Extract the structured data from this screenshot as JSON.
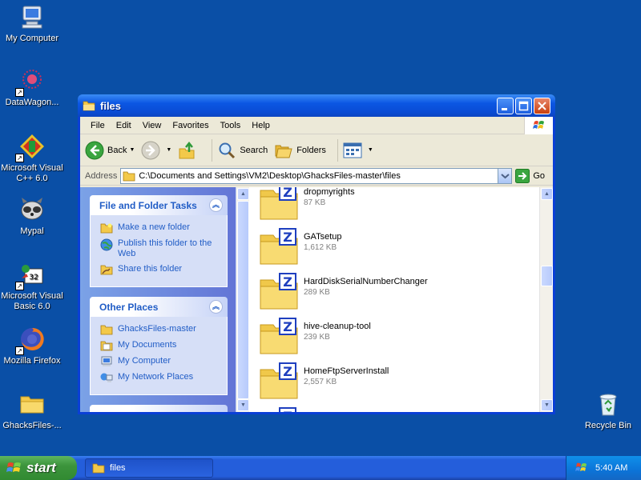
{
  "desktop": {
    "icons": [
      {
        "label": "My Computer",
        "icon": "my-computer-icon"
      },
      {
        "label": "DataWagon...",
        "icon": "datawagon-icon"
      },
      {
        "label": "Microsoft Visual C++ 6.0",
        "icon": "visual-cpp-icon"
      },
      {
        "label": "Mypal",
        "icon": "mypal-icon"
      },
      {
        "label": "Microsoft Visual Basic 6.0",
        "icon": "visual-basic-icon"
      },
      {
        "label": "Mozilla Firefox",
        "icon": "firefox-icon"
      },
      {
        "label": "GhacksFiles-...",
        "icon": "folder-icon"
      },
      {
        "label": "Recycle Bin",
        "icon": "recycle-bin-icon"
      }
    ]
  },
  "window": {
    "title": "files",
    "menu": [
      "File",
      "Edit",
      "View",
      "Favorites",
      "Tools",
      "Help"
    ],
    "toolbar": {
      "back_label": "Back",
      "search_label": "Search",
      "folders_label": "Folders"
    },
    "address": {
      "label": "Address",
      "value": "C:\\Documents and Settings\\VM2\\Desktop\\GhacksFiles-master\\files",
      "go_label": "Go"
    },
    "taskpane": {
      "file_folder_tasks": {
        "title": "File and Folder Tasks",
        "items": [
          {
            "label": "Make a new folder",
            "icon": "new-folder-icon"
          },
          {
            "label": "Publish this folder to the Web",
            "icon": "publish-web-icon"
          },
          {
            "label": "Share this folder",
            "icon": "share-folder-icon"
          }
        ]
      },
      "other_places": {
        "title": "Other Places",
        "items": [
          {
            "label": "GhacksFiles-master",
            "icon": "folder-icon"
          },
          {
            "label": "My Documents",
            "icon": "my-documents-icon"
          },
          {
            "label": "My Computer",
            "icon": "my-computer-icon"
          },
          {
            "label": "My Network Places",
            "icon": "network-places-icon"
          }
        ]
      }
    },
    "files": [
      {
        "name": "dropmyrights",
        "size": "87 KB"
      },
      {
        "name": "GATsetup",
        "size": "1,612 KB"
      },
      {
        "name": "HardDiskSerialNumberChanger",
        "size": "289 KB"
      },
      {
        "name": "hive-cleanup-tool",
        "size": "239 KB"
      },
      {
        "name": "HomeFtpServerInstall",
        "size": "2,557 KB"
      }
    ]
  },
  "taskbar": {
    "start_label": "start",
    "task_label": "files",
    "clock": "5:40 AM"
  },
  "colors": {
    "desktop_bg": "#0a4fa6",
    "titlebar": "#0b56e3",
    "taskpane_text": "#215dc6",
    "start_green": "#3c943c"
  }
}
